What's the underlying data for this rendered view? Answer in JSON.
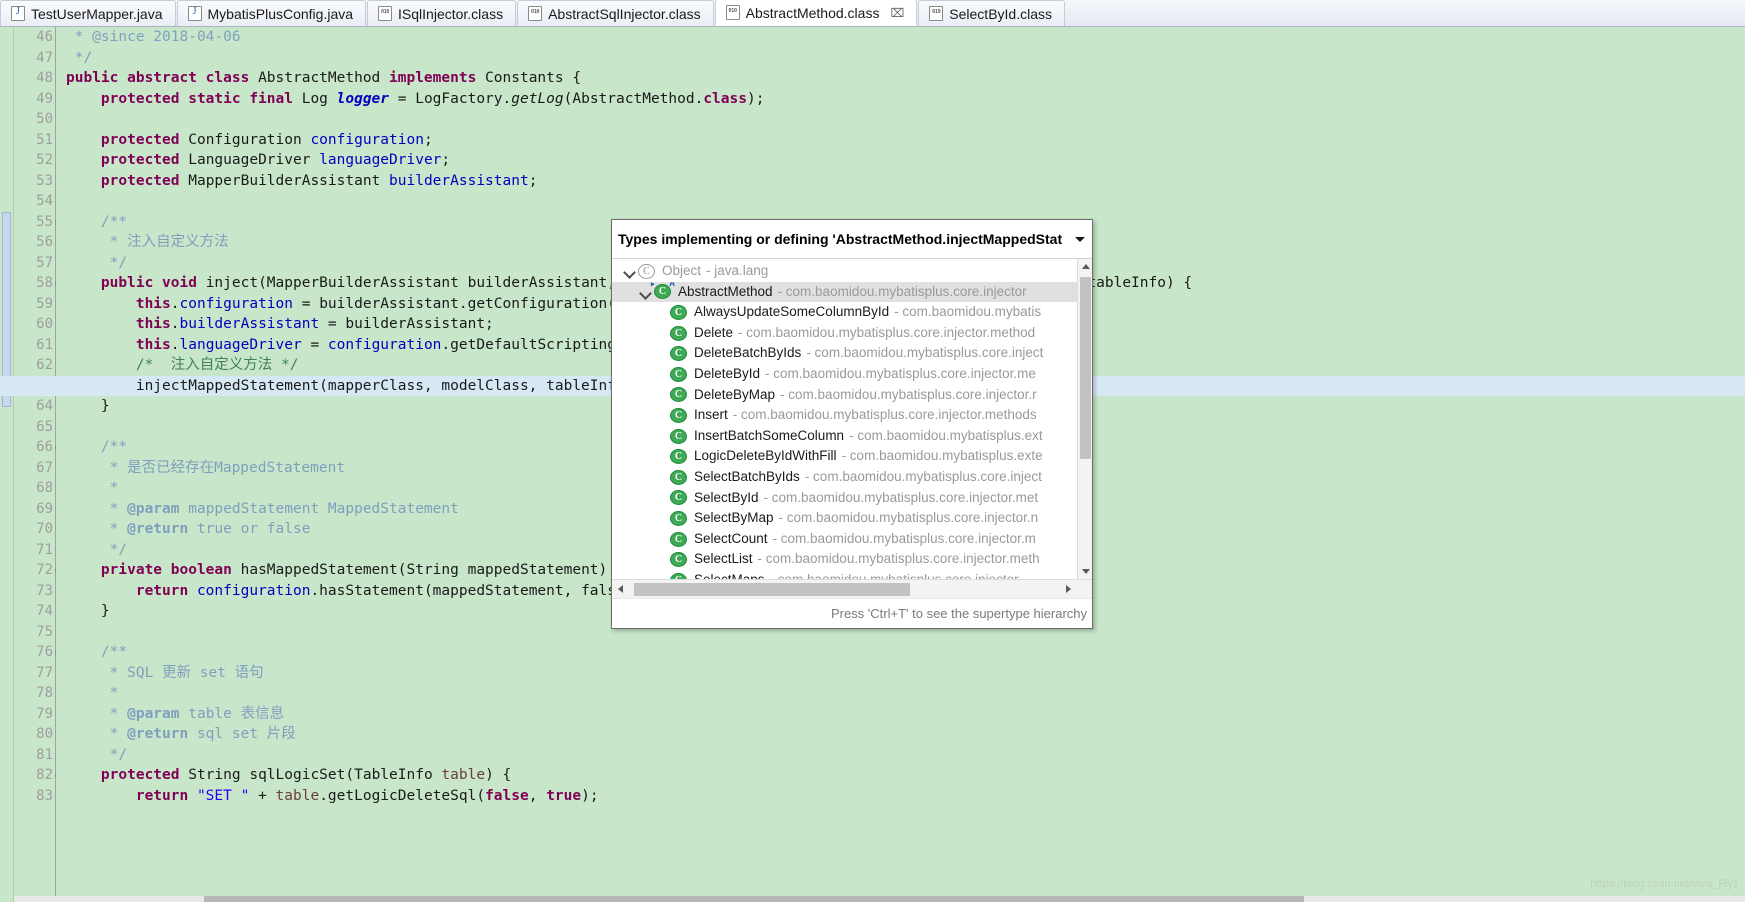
{
  "tabs": [
    {
      "label": "TestUserMapper.java",
      "icon": "java-file-icon",
      "active": false,
      "closable": false
    },
    {
      "label": "MybatisPlusConfig.java",
      "icon": "java-file-icon",
      "active": false,
      "closable": false
    },
    {
      "label": "ISqlInjector.class",
      "icon": "class-file-icon",
      "active": false,
      "closable": false
    },
    {
      "label": "AbstractSqlInjector.class",
      "icon": "class-file-icon",
      "active": false,
      "closable": false
    },
    {
      "label": "AbstractMethod.class",
      "icon": "class-file-icon",
      "active": true,
      "closable": true,
      "close_glyph": "⌧"
    },
    {
      "label": "SelectById.class",
      "icon": "class-file-icon",
      "active": false,
      "closable": false
    }
  ],
  "editor": {
    "background_color": "#c8e6c9",
    "highlight_color": "#d7e8f5",
    "first_line": 46,
    "lines": [
      {
        "n": 46,
        "fold": false,
        "tokens": [
          {
            "t": " * @since 2018-04-06",
            "c": "cmt"
          }
        ]
      },
      {
        "n": 47,
        "fold": false,
        "tokens": [
          {
            "t": " */",
            "c": "cmt"
          }
        ]
      },
      {
        "n": 48,
        "fold": false,
        "tokens": [
          {
            "t": "public abstract class ",
            "c": "kw"
          },
          {
            "t": "AbstractMethod ",
            "c": "plain"
          },
          {
            "t": "implements ",
            "c": "kw"
          },
          {
            "t": "Constants {",
            "c": "plain"
          }
        ]
      },
      {
        "n": 49,
        "fold": false,
        "tokens": [
          {
            "t": "    ",
            "c": "plain"
          },
          {
            "t": "protected static final ",
            "c": "kw"
          },
          {
            "t": "Log ",
            "c": "plain"
          },
          {
            "t": "logger",
            "c": "fldi"
          },
          {
            "t": " = LogFactory.",
            "c": "plain"
          },
          {
            "t": "getLog",
            "c": "sm"
          },
          {
            "t": "(AbstractMethod.",
            "c": "plain"
          },
          {
            "t": "class",
            "c": "kw"
          },
          {
            "t": ");",
            "c": "plain"
          }
        ]
      },
      {
        "n": 50,
        "fold": false,
        "tokens": []
      },
      {
        "n": 51,
        "fold": false,
        "tokens": [
          {
            "t": "    ",
            "c": "plain"
          },
          {
            "t": "protected ",
            "c": "kw"
          },
          {
            "t": "Configuration ",
            "c": "plain"
          },
          {
            "t": "configuration",
            "c": "fld"
          },
          {
            "t": ";",
            "c": "plain"
          }
        ]
      },
      {
        "n": 52,
        "fold": false,
        "tokens": [
          {
            "t": "    ",
            "c": "plain"
          },
          {
            "t": "protected ",
            "c": "kw"
          },
          {
            "t": "LanguageDriver ",
            "c": "plain"
          },
          {
            "t": "languageDriver",
            "c": "fld"
          },
          {
            "t": ";",
            "c": "plain"
          }
        ]
      },
      {
        "n": 53,
        "fold": false,
        "tokens": [
          {
            "t": "    ",
            "c": "plain"
          },
          {
            "t": "protected ",
            "c": "kw"
          },
          {
            "t": "MapperBuilderAssistant ",
            "c": "plain"
          },
          {
            "t": "builderAssistant",
            "c": "fld"
          },
          {
            "t": ";",
            "c": "plain"
          }
        ]
      },
      {
        "n": 54,
        "fold": false,
        "tokens": []
      },
      {
        "n": 55,
        "fold": true,
        "tokens": [
          {
            "t": "    /**",
            "c": "cmt"
          }
        ]
      },
      {
        "n": 56,
        "fold": false,
        "tokens": [
          {
            "t": "     * 注入自定义方法",
            "c": "cmt"
          }
        ]
      },
      {
        "n": 57,
        "fold": false,
        "tokens": [
          {
            "t": "     */",
            "c": "cmt"
          }
        ]
      },
      {
        "n": 58,
        "fold": true,
        "tokens": [
          {
            "t": "    ",
            "c": "plain"
          },
          {
            "t": "public void ",
            "c": "kw"
          },
          {
            "t": "inject",
            "c": "plain"
          },
          {
            "t": "(MapperBuilderAssistant builderAssistant, Class<?> mapperClass, Class<?> modelClass, TableInfo tableInfo) {",
            "c": "plain"
          }
        ]
      },
      {
        "n": 59,
        "fold": false,
        "tokens": [
          {
            "t": "        ",
            "c": "plain"
          },
          {
            "t": "this",
            "c": "kw"
          },
          {
            "t": ".",
            "c": "plain"
          },
          {
            "t": "configuration",
            "c": "fld"
          },
          {
            "t": " = builderAssistant.getConfiguration();",
            "c": "plain"
          }
        ]
      },
      {
        "n": 60,
        "fold": false,
        "tokens": [
          {
            "t": "        ",
            "c": "plain"
          },
          {
            "t": "this",
            "c": "kw"
          },
          {
            "t": ".",
            "c": "plain"
          },
          {
            "t": "builderAssistant",
            "c": "fld"
          },
          {
            "t": " = builderAssistant;",
            "c": "plain"
          }
        ]
      },
      {
        "n": 61,
        "fold": false,
        "tokens": [
          {
            "t": "        ",
            "c": "plain"
          },
          {
            "t": "this",
            "c": "kw"
          },
          {
            "t": ".",
            "c": "plain"
          },
          {
            "t": "languageDriver",
            "c": "fld"
          },
          {
            "t": " = ",
            "c": "plain"
          },
          {
            "t": "configuration",
            "c": "fld"
          },
          {
            "t": ".getDefaultScriptingLanguageInstance();",
            "c": "plain"
          }
        ]
      },
      {
        "n": 62,
        "fold": false,
        "tokens": [
          {
            "t": "        /*  注入自定义方法 */",
            "c": "cm"
          }
        ]
      },
      {
        "n": 63,
        "fold": false,
        "highlight": true,
        "tokens": [
          {
            "t": "        injectMappedStatement(mapperClass, modelClass, tableInfo);",
            "c": "plain"
          }
        ]
      },
      {
        "n": 64,
        "fold": false,
        "tokens": [
          {
            "t": "    }",
            "c": "plain"
          }
        ]
      },
      {
        "n": 65,
        "fold": false,
        "tokens": []
      },
      {
        "n": 66,
        "fold": true,
        "tokens": [
          {
            "t": "    /**",
            "c": "cmt"
          }
        ]
      },
      {
        "n": 67,
        "fold": false,
        "tokens": [
          {
            "t": "     * 是否已经存在MappedStatement",
            "c": "cmt"
          }
        ]
      },
      {
        "n": 68,
        "fold": false,
        "tokens": [
          {
            "t": "     *",
            "c": "cmt"
          }
        ]
      },
      {
        "n": 69,
        "fold": false,
        "tokens": [
          {
            "t": "     * ",
            "c": "cmt"
          },
          {
            "t": "@param",
            "c": "cmtag"
          },
          {
            "t": " mappedStatement MappedStatement",
            "c": "cmt"
          }
        ]
      },
      {
        "n": 70,
        "fold": false,
        "tokens": [
          {
            "t": "     * ",
            "c": "cmt"
          },
          {
            "t": "@return",
            "c": "cmtag"
          },
          {
            "t": " true or false",
            "c": "cmt"
          }
        ]
      },
      {
        "n": 71,
        "fold": false,
        "tokens": [
          {
            "t": "     */",
            "c": "cmt"
          }
        ]
      },
      {
        "n": 72,
        "fold": true,
        "tokens": [
          {
            "t": "    ",
            "c": "plain"
          },
          {
            "t": "private boolean ",
            "c": "kw"
          },
          {
            "t": "hasMappedStatement",
            "c": "plain"
          },
          {
            "t": "(String mappedStatement) {",
            "c": "plain"
          }
        ]
      },
      {
        "n": 73,
        "fold": false,
        "tokens": [
          {
            "t": "        ",
            "c": "plain"
          },
          {
            "t": "return ",
            "c": "kw"
          },
          {
            "t": "configuration",
            "c": "fld"
          },
          {
            "t": ".hasStatement(mappedStatement, false);",
            "c": "plain"
          }
        ]
      },
      {
        "n": 74,
        "fold": false,
        "tokens": [
          {
            "t": "    }",
            "c": "plain"
          }
        ]
      },
      {
        "n": 75,
        "fold": false,
        "tokens": []
      },
      {
        "n": 76,
        "fold": true,
        "tokens": [
          {
            "t": "    /**",
            "c": "cmt"
          }
        ]
      },
      {
        "n": 77,
        "fold": false,
        "tokens": [
          {
            "t": "     * SQL 更新 set 语句",
            "c": "cmt"
          }
        ]
      },
      {
        "n": 78,
        "fold": false,
        "tokens": [
          {
            "t": "     *",
            "c": "cmt"
          }
        ]
      },
      {
        "n": 79,
        "fold": false,
        "tokens": [
          {
            "t": "     * ",
            "c": "cmt"
          },
          {
            "t": "@param",
            "c": "cmtag"
          },
          {
            "t": " table 表信息",
            "c": "cmt"
          }
        ]
      },
      {
        "n": 80,
        "fold": false,
        "tokens": [
          {
            "t": "     * ",
            "c": "cmt"
          },
          {
            "t": "@return",
            "c": "cmtag"
          },
          {
            "t": " sql set 片段",
            "c": "cmt"
          }
        ]
      },
      {
        "n": 81,
        "fold": false,
        "tokens": [
          {
            "t": "     */",
            "c": "cmt"
          }
        ]
      },
      {
        "n": 82,
        "fold": true,
        "tokens": [
          {
            "t": "    ",
            "c": "plain"
          },
          {
            "t": "protected ",
            "c": "kw"
          },
          {
            "t": "String ",
            "c": "plain"
          },
          {
            "t": "sqlLogicSet",
            "c": "plain"
          },
          {
            "t": "(TableInfo ",
            "c": "plain"
          },
          {
            "t": "table",
            "c": "prm"
          },
          {
            "t": ") {",
            "c": "plain"
          }
        ]
      },
      {
        "n": 83,
        "fold": false,
        "tokens": [
          {
            "t": "        ",
            "c": "plain"
          },
          {
            "t": "return ",
            "c": "kw"
          },
          {
            "t": "\"SET \"",
            "c": "str"
          },
          {
            "t": " + ",
            "c": "plain"
          },
          {
            "t": "table",
            "c": "prm"
          },
          {
            "t": ".getLogicDeleteSql(",
            "c": "plain"
          },
          {
            "t": "false",
            "c": "kw"
          },
          {
            "t": ", ",
            "c": "plain"
          },
          {
            "t": "true",
            "c": "kw"
          },
          {
            "t": ");",
            "c": "plain"
          }
        ]
      }
    ]
  },
  "popup": {
    "title": "Types implementing or defining 'AbstractMethod.injectMappedStat",
    "caret_icon": "chevron-down-icon",
    "status_text": "Press 'Ctrl+T' to see the supertype hierarchy",
    "tree": [
      {
        "indent": 0,
        "twisty": "open",
        "icon": "interface-icon",
        "name": "Object",
        "pkg": "- java.lang",
        "selected": false,
        "muted": true
      },
      {
        "indent": 1,
        "twisty": "open",
        "icon": "abstract-class-icon",
        "name": "AbstractMethod",
        "pkg": "- com.baomidou.mybatisplus.core.injector",
        "selected": true,
        "muted": false
      },
      {
        "indent": 2,
        "twisty": "none",
        "icon": "class-icon",
        "name": "AlwaysUpdateSomeColumnById",
        "pkg": "- com.baomidou.mybatis",
        "selected": false,
        "muted": false
      },
      {
        "indent": 2,
        "twisty": "none",
        "icon": "class-icon",
        "name": "Delete",
        "pkg": "- com.baomidou.mybatisplus.core.injector.method",
        "selected": false,
        "muted": false
      },
      {
        "indent": 2,
        "twisty": "none",
        "icon": "class-icon",
        "name": "DeleteBatchByIds",
        "pkg": "- com.baomidou.mybatisplus.core.inject",
        "selected": false,
        "muted": false
      },
      {
        "indent": 2,
        "twisty": "none",
        "icon": "class-icon",
        "name": "DeleteById",
        "pkg": "- com.baomidou.mybatisplus.core.injector.me",
        "selected": false,
        "muted": false
      },
      {
        "indent": 2,
        "twisty": "none",
        "icon": "class-icon",
        "name": "DeleteByMap",
        "pkg": "- com.baomidou.mybatisplus.core.injector.r",
        "selected": false,
        "muted": false
      },
      {
        "indent": 2,
        "twisty": "none",
        "icon": "class-icon",
        "name": "Insert",
        "pkg": "- com.baomidou.mybatisplus.core.injector.methods",
        "selected": false,
        "muted": false
      },
      {
        "indent": 2,
        "twisty": "none",
        "icon": "class-icon",
        "name": "InsertBatchSomeColumn",
        "pkg": "- com.baomidou.mybatisplus.ext",
        "selected": false,
        "muted": false
      },
      {
        "indent": 2,
        "twisty": "none",
        "icon": "class-icon",
        "name": "LogicDeleteByIdWithFill",
        "pkg": "- com.baomidou.mybatisplus.exte",
        "selected": false,
        "muted": false
      },
      {
        "indent": 2,
        "twisty": "none",
        "icon": "class-icon",
        "name": "SelectBatchByIds",
        "pkg": "- com.baomidou.mybatisplus.core.inject",
        "selected": false,
        "muted": false
      },
      {
        "indent": 2,
        "twisty": "none",
        "icon": "class-icon",
        "name": "SelectById",
        "pkg": "- com.baomidou.mybatisplus.core.injector.met",
        "selected": false,
        "muted": false
      },
      {
        "indent": 2,
        "twisty": "none",
        "icon": "class-icon",
        "name": "SelectByMap",
        "pkg": "- com.baomidou.mybatisplus.core.injector.n",
        "selected": false,
        "muted": false
      },
      {
        "indent": 2,
        "twisty": "none",
        "icon": "class-icon",
        "name": "SelectCount",
        "pkg": "- com.baomidou.mybatisplus.core.injector.m",
        "selected": false,
        "muted": false
      },
      {
        "indent": 2,
        "twisty": "none",
        "icon": "class-icon",
        "name": "SelectList",
        "pkg": "- com.baomidou.mybatisplus.core.injector.meth",
        "selected": false,
        "muted": false
      },
      {
        "indent": 2,
        "twisty": "none",
        "icon": "class-icon",
        "name": "SelectMaps",
        "pkg": "- com.baomidou.mybatisplus.core.injector.",
        "selected": false,
        "muted": false
      }
    ]
  },
  "watermark": "https://blog.csdn.net/java_Fly1"
}
